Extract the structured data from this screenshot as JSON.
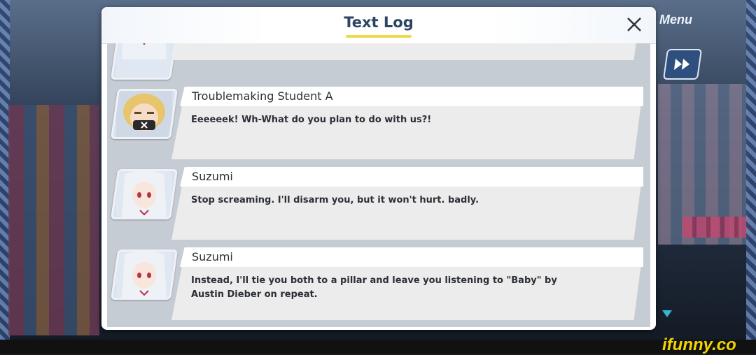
{
  "window": {
    "title": "Text Log"
  },
  "hud": {
    "menu_label": "Menu"
  },
  "entries": [
    {
      "speaker": "",
      "text": "",
      "avatar": "suzumi-portrait"
    },
    {
      "speaker": "Troublemaking Student A",
      "text": "Eeeeeek! Wh-What do you plan to do with us?!",
      "avatar": "troublemaking-student-portrait"
    },
    {
      "speaker": "Suzumi",
      "text": "Stop screaming. I'll disarm you, but it won't hurt. badly.",
      "avatar": "suzumi-portrait"
    },
    {
      "speaker": "Suzumi",
      "text": "Instead, I'll tie you both to a pillar and leave you listening to \"Baby\" by Austin Dieber on repeat.",
      "avatar": "suzumi-portrait"
    }
  ],
  "watermark": {
    "text": "ifunny.co"
  },
  "colors": {
    "title": "#2d4565",
    "title_underline": "#f0d94a",
    "accent_arrow": "#36b5d8",
    "watermark": "#f2d400"
  }
}
